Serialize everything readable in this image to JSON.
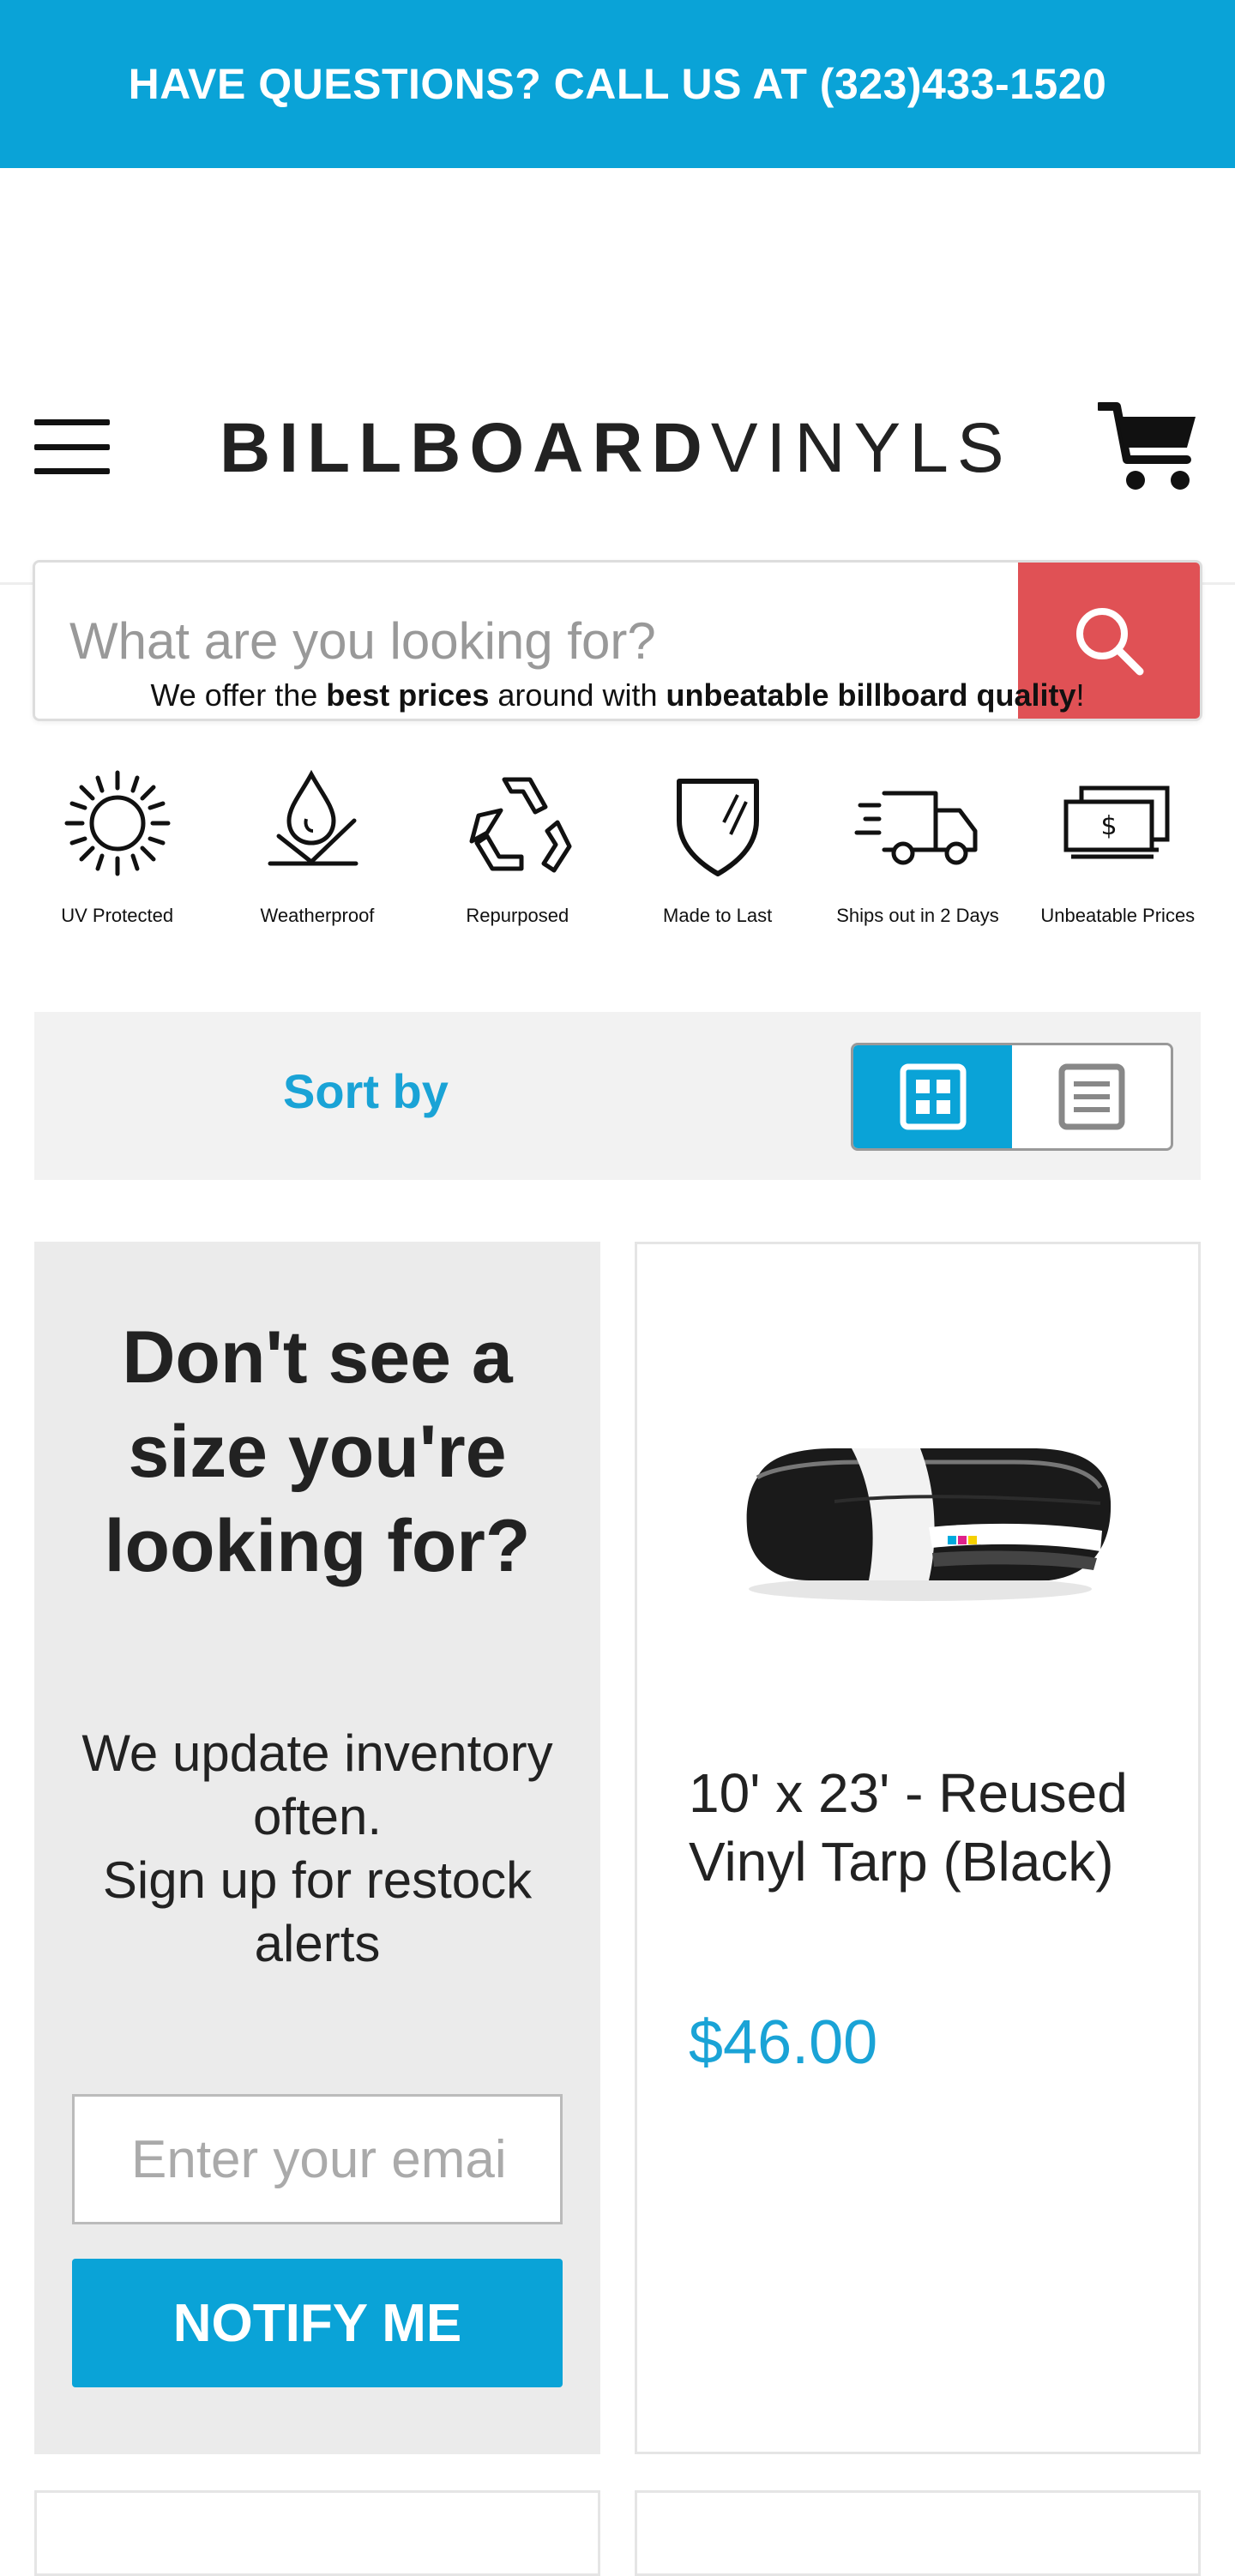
{
  "promo_bar": {
    "text": "HAVE QUESTIONS? CALL US AT (323)433-1520"
  },
  "header": {
    "logo_bold": "BILLBOARD",
    "logo_light": "VINYLS",
    "search_placeholder": "What are you looking for?"
  },
  "offer": {
    "prefix": "We offer the ",
    "bold1": "best prices",
    "middle": " around with ",
    "bold2": "unbeatable billboard quality",
    "suffix": "!"
  },
  "features": [
    {
      "label": "UV Protected",
      "icon": "sun-icon"
    },
    {
      "label": "Weatherproof",
      "icon": "water-drop-icon"
    },
    {
      "label": "Repurposed",
      "icon": "recycle-icon"
    },
    {
      "label": "Made to Last",
      "icon": "shield-icon"
    },
    {
      "label": "Ships out in 2 Days",
      "icon": "truck-icon"
    },
    {
      "label": "Unbeatable Prices",
      "icon": "money-icon"
    }
  ],
  "sort": {
    "label": "Sort by",
    "active_view": "grid"
  },
  "restock_promo": {
    "title": "Don't see a size you're looking for?",
    "line1": "We update inventory often.",
    "line2": "Sign up for restock alerts",
    "email_placeholder": "Enter your email",
    "button": "NOTIFY ME"
  },
  "products": [
    {
      "title": "10' x 23' - Reused Vinyl Tarp (Black)",
      "price": "$46.00"
    }
  ],
  "colors": {
    "accent": "#0aa3d7",
    "search_button": "#e05155",
    "promo_card_bg": "#ebebeb"
  }
}
